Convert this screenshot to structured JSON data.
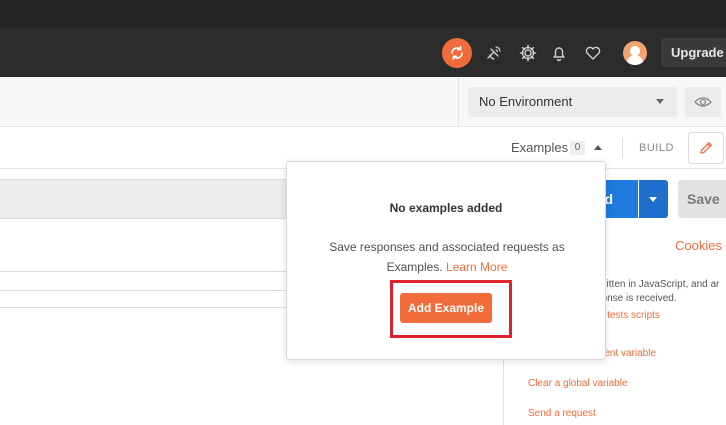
{
  "header": {
    "upgrade_label": "Upgrade",
    "icons": [
      "sync-icon",
      "satellite-icon",
      "settings-icon",
      "bell-icon",
      "heart-icon",
      "avatar"
    ]
  },
  "environment": {
    "selected": "No Environment"
  },
  "request_toolbar": {
    "examples_label": "Examples",
    "examples_count": "0",
    "build_label": "BUILD"
  },
  "url_bar": {
    "send_label_visible": "nd",
    "save_label": "Save"
  },
  "right_panel": {
    "cookies_label": "Cookies",
    "text_line_1": "written in JavaScript, and ar",
    "text_line_2": "ponse is received.",
    "link_tests": "ut tests scripts",
    "link_env_var": "ment variable",
    "link_clear_global": "Clear a global variable",
    "link_send_request": "Send a request"
  },
  "examples_popover": {
    "title": "No examples added",
    "description": "Save responses and associated requests as Examples.",
    "learn_more": "Learn More",
    "button_label": "Add Example"
  },
  "colors": {
    "accent": "#f26b3a",
    "send_blue": "#1f7ae0",
    "highlight_red": "#e0212e",
    "topbar": "#2c2c2c"
  }
}
